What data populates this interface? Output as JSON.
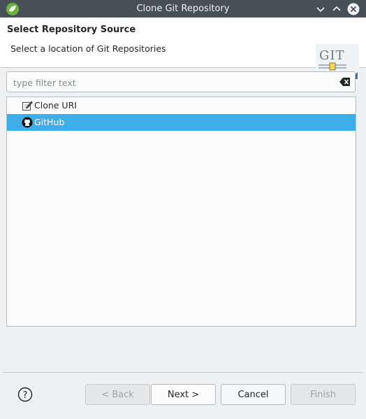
{
  "window": {
    "title": "Clone Git Repository"
  },
  "banner": {
    "heading": "Select Repository Source",
    "description": "Select a location of Git Repositories",
    "logo_text": "GIT"
  },
  "filter": {
    "placeholder": "type filter text",
    "value": ""
  },
  "sources": [
    {
      "label": "Clone URI",
      "icon": "clone-uri-icon",
      "selected": false
    },
    {
      "label": "GitHub",
      "icon": "github-icon",
      "selected": true
    }
  ],
  "buttons": {
    "back": "< Back",
    "next": "Next >",
    "cancel": "Cancel",
    "finish": "Finish"
  },
  "colors": {
    "selection": "#3daee9",
    "titlebar": "#475057"
  }
}
